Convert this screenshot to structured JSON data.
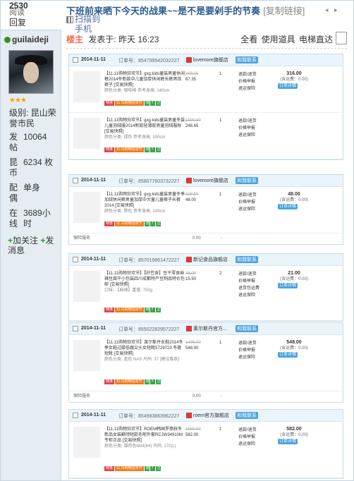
{
  "left": {
    "top_count": "2530",
    "top_label1": "阅读",
    "top_label2": "回复",
    "username": "guilaideji",
    "stars": "★★★",
    "level": "级别: 昆山荣誉市民",
    "posts_k": "发帖",
    "posts_v": "10064",
    "coins_k": "昆币",
    "coins_v": "6234 枚",
    "spouse_k": "配偶",
    "spouse_v": "单身",
    "online_k": "在线",
    "online_v": "3689小时",
    "follow": "加关注",
    "message": "发消息"
  },
  "post": {
    "title": "下班前来晒下今天的战果~~是不是要剁手的节奏",
    "copy_link": "[复制链接]",
    "scan_line1": "扫描到",
    "scan_line2": "手机",
    "host": "楼主",
    "time": "发表于: 昨天 16:23",
    "view_all": "全看",
    "use_tool": "使用道具",
    "elevator": "电梯直达"
  },
  "orders": [
    {
      "date": "2014-11-11",
      "order_no": "订单号：854799542032227",
      "shop": "lovemore旗舰店",
      "contact": "和我联系",
      "items": [
        {
          "desc": "【11.11购物狂欢节】gxg.kids童装男童休闲裤2014冬新款中儿童加厚休闲裤长裤男孩裤子 [交易快照]",
          "sub": "颜色分类: 咖啡格 参考身高: 140cm",
          "orig": "348.00",
          "price": "67.35",
          "qty": "1",
          "svc1": "退款/退货",
          "svc2": "价格举报",
          "svc3": "退运保险",
          "total": "316.00",
          "fee": "(含运费：0.00)",
          "detail": "订单详情"
        },
        {
          "desc": "【11.11购物狂欢节】gxg.kids童装男童冬装儿童羽绒服2014新款轻薄款男童羽绒服秋 [交易快照]",
          "sub": "颜色分类: 绿色 参考身高: 150cm",
          "orig": "1000.00",
          "price": "248.65",
          "qty": "1",
          "svc1": "退款/退货",
          "svc2": "价格举报",
          "svc3": "退运保险"
        }
      ]
    },
    {
      "date": "2014-11-11",
      "order_no": "订单号：858077603732227",
      "shop": "lovemore旗舰店",
      "contact": "和我联系",
      "items": [
        {
          "desc": "【11.11购物狂欢节】gxg.kids童装男童冬季加绒休闲裤男童加厚中大童儿童裤子长裤 2014 [交易快照]",
          "sub": "颜色分类: 黑色 参考身高: 140cm",
          "orig": "328.00",
          "price": "48.00",
          "qty": "1",
          "svc1": "退款/退货",
          "svc2": "价格举报",
          "svc3": "退运保险",
          "total": "48.00",
          "fee": "(含运费：0.00)",
          "detail": "订单详情"
        }
      ],
      "service": {
        "label": "保险服务",
        "price": "0.00",
        "qty": "-"
      }
    },
    {
      "date": "2014-11-11",
      "order_no": "订单号：857019861472227",
      "shop": "新记食品旗舰店",
      "contact": "和我联系",
      "items": [
        {
          "desc": "【11.11购物狂欢节】【好巴食】豆干零食麻辣豆腐干小包装四川成都特产豆制品特价包邮 [交易快照]",
          "sub": "口味: 【麻辣】重量: 750g",
          "orig": "36.00",
          "price": "15.50",
          "qty": "2",
          "svc1": "退款/退货",
          "svc2": "价格举报",
          "svc3": "退货包运费",
          "svc4": "退运保险",
          "total": "21.00",
          "fee": "(含运费：0.00)",
          "detail": "订单详情"
        }
      ]
    },
    {
      "date": "2014-11-11",
      "order_no": "订单号：855022829572227",
      "shop": "莱尔斯丹官方...",
      "contact": "和我联系",
      "items": [
        {
          "desc": "【11.11购物狂欢节】莱尔斯丹女鞋2014冬季女鞋过膝低跟尖头女短靴5T29723 冬靴短靴 [交易快照]",
          "sub": "颜色分类: 蓝色 NAS 尺码: 37 [建议客款]",
          "orig": "1498.00",
          "price": "548.00",
          "qty": "1",
          "svc1": "退款/退货",
          "svc2": "价格举报",
          "svc3": "退运保险",
          "total": "548.00",
          "fee": "(含运费：0.00)",
          "detail": "订单详情"
        }
      ],
      "service": {
        "label": "保险服务",
        "price": "0.00",
        "qty": "-"
      }
    },
    {
      "date": "2014-11-11",
      "order_no": "订单号：854983863962227",
      "shop": "roem官方旗舰店",
      "contact": "和我联系",
      "items": [
        {
          "desc": "【11.11购物狂欢节】ROEM韩国罗燕秋冬新品女装翻领短款毛呢外套RCJW34910M专柜正品 [交易快照]",
          "sub": "颜色分类: 薄荷色Mint(84) 尺码: 170(L)",
          "orig": "1580.00",
          "price": "582.00",
          "qty": "1",
          "svc1": "退款/退货",
          "svc2": "价格举报",
          "svc3": "退运保险",
          "total": "582.00",
          "fee": "(含运费：0.00)",
          "detail": "订单详情"
        }
      ]
    }
  ],
  "tags": {
    "t1": "特惠",
    "t2": "11.11购物狂欢节",
    "t3a": "赠",
    "t3b": "7",
    "t3c": "正"
  },
  "colors": {
    "accent": "#2a5a8f",
    "host": "#f26c4f",
    "left_bg": "#e5edf2",
    "order_head": "#eaf4fb"
  }
}
